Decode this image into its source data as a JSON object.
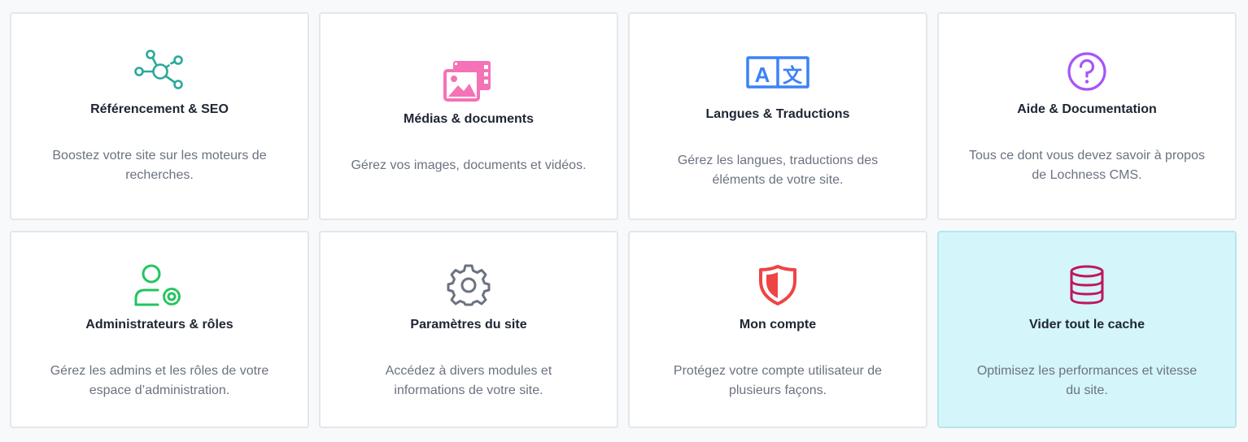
{
  "cards": [
    {
      "title": "Référencement & SEO",
      "description": "Boostez votre site sur les moteurs de recherches.",
      "icon": "network-icon",
      "color": "#2aa89a"
    },
    {
      "title": "Médias & documents",
      "description": "Gérez vos images, documents et vidéos.",
      "icon": "media-icon",
      "color": "#f472b6"
    },
    {
      "title": "Langues & Traductions",
      "description": "Gérez les langues, traductions des éléments de votre site.",
      "icon": "translate-icon",
      "color": "#3b82f6"
    },
    {
      "title": "Aide & Documentation",
      "description": "Tous ce dont vous devez savoir à propos de Lochness CMS.",
      "icon": "question-icon",
      "color": "#a855f7"
    },
    {
      "title": "Administrateurs & rôles",
      "description": "Gérez les admins et les rôles de votre espace d’administration.",
      "icon": "user-gear-icon",
      "color": "#22c55e"
    },
    {
      "title": "Paramètres du site",
      "description": "Accédez à divers modules et informations de votre site.",
      "icon": "gear-icon",
      "color": "#6b7280"
    },
    {
      "title": "Mon compte",
      "description": "Protégez votre compte utilisateur de plusieurs façons.",
      "icon": "shield-icon",
      "color": "#ef4444"
    },
    {
      "title": "Vider tout le cache",
      "description": "Optimisez les performances et vitesse du site.",
      "icon": "database-icon",
      "color": "#be185d"
    }
  ]
}
